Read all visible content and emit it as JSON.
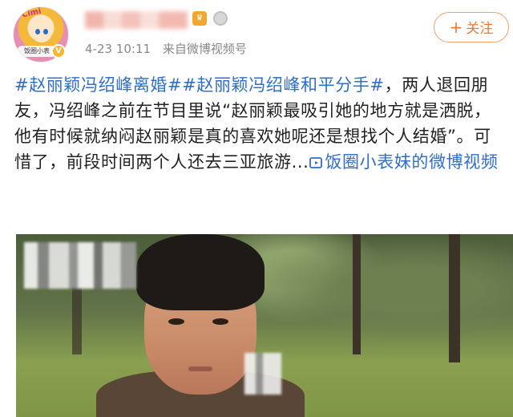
{
  "header": {
    "avatar_brand": "Cimi",
    "avatar_nameplate": "饭圈小表",
    "verified_badge": "V",
    "meta_time": "4-23 10:11",
    "meta_source": "来自微博视频号",
    "follow_label": "关注"
  },
  "post": {
    "tag1": "#赵丽颖冯绍峰离婚#",
    "tag2": "#赵丽颖冯绍峰和平分手#",
    "text": "，两人退回朋友，冯绍峰之前在节目里说“赵丽颖最吸引她的地方就是洒脱，他有时候就纳闷赵丽颖是真的喜欢她呢还是想找个人结婚”。可惜了，前段时间两个人还去三亚旅游...",
    "video_link": "饭圈小表妹的微博视频"
  },
  "colors": {
    "link": "#2f6ec9",
    "follow": "#ef7a2a",
    "meta": "#888888"
  },
  "icons": {
    "follow": "plus-icon",
    "video_link": "video-icon",
    "verified": "verified-v-icon"
  }
}
